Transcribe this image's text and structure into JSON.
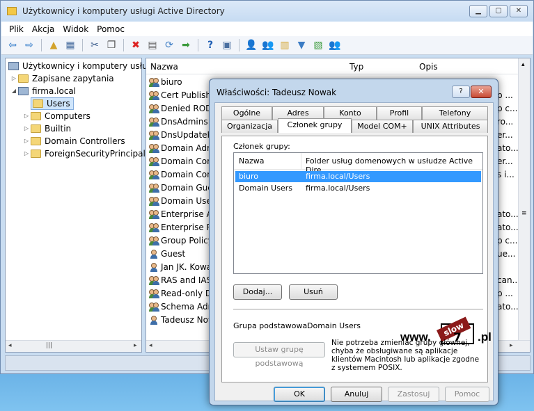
{
  "window": {
    "title": "Użytkownicy i komputery usługi Active Directory"
  },
  "menu": [
    "Plik",
    "Akcja",
    "Widok",
    "Pomoc"
  ],
  "tree": {
    "root": "Użytkownicy i komputery usługi",
    "saved": "Zapisane zapytania",
    "domain": "firma.local",
    "children": [
      "Users",
      "Computers",
      "Builtin",
      "Domain Controllers",
      "ForeignSecurityPrincipals"
    ]
  },
  "list": {
    "columns": [
      "Nazwa",
      "Typ",
      "Opis"
    ],
    "rows": [
      "biuro",
      "Cert Publishe",
      "Denied RODC",
      "DnsAdmins",
      "DnsUpdatePr",
      "Domain Adm",
      "Domain Con",
      "Domain Con",
      "Domain Gue",
      "Domain User",
      "Enterprise Ac",
      "Enterprise Re",
      "Group Policy",
      "Guest",
      "Jan JK. Kowa",
      "RAS and IAS",
      "Read-only D",
      "Schema Adm",
      "Tadeusz Now"
    ],
    "desc": [
      "",
      "p ...",
      "p c...",
      "ro...",
      "er...",
      "ato...",
      "er...",
      "s i...",
      "",
      "",
      "ato...",
      "ato...",
      "p c...",
      "ue...",
      "",
      "can...",
      "p ...",
      "ato...",
      ""
    ]
  },
  "dialog": {
    "title": "Właściwości: Tadeusz Nowak",
    "help": "?",
    "close": "✕",
    "tabs_row1": [
      "Ogólne",
      "Adres",
      "Konto",
      "Profil",
      "Telefony"
    ],
    "tabs_row2": [
      "Organizacja",
      "Członek grupy",
      "Model COM+",
      "UNIX Attributes"
    ],
    "member_label": "Członek grupy:",
    "col_name": "Nazwa",
    "col_folder": "Folder usług domenowych w usłudze Active Dire...",
    "members": [
      {
        "name": "biuro",
        "folder": "firma.local/Users"
      },
      {
        "name": "Domain Users",
        "folder": "firma.local/Users"
      }
    ],
    "add": "Dodaj...",
    "remove": "Usuń",
    "primary_label": "Grupa podstawowa:",
    "primary_value": "Domain Users",
    "set_primary": "Ustaw grupę podstawową",
    "note": "Nie potrzeba zmieniać grupy głównej, chyba że obsługiwane są aplikacje klientów Macintosh lub aplikacje zgodne z systemem POSIX.",
    "ok": "OK",
    "cancel": "Anuluj",
    "apply": "Zastosuj",
    "helpbtn": "Pomoc"
  },
  "watermark": {
    "pre": "www.",
    "banner": "slow",
    "num": "7",
    "post": ".pl"
  }
}
